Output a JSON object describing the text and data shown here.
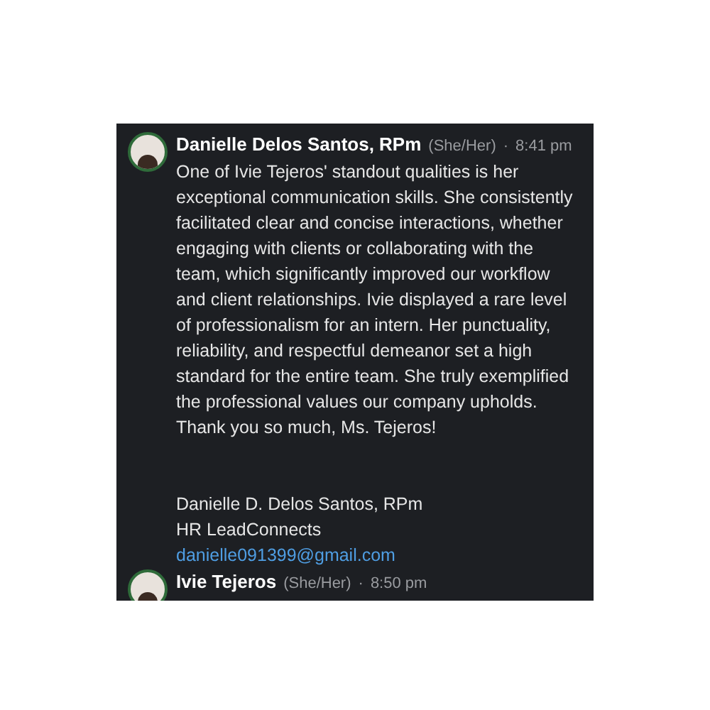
{
  "messages": [
    {
      "author": "Danielle Delos Santos, RPm",
      "pronouns": "(She/Her)",
      "separator": "·",
      "time": "8:41 pm",
      "body_lines": [
        "One of Ivie Tejeros' standout qualities is her",
        "exceptional communication skills. She consistently",
        "facilitated clear and concise interactions, whether",
        "engaging with clients or collaborating with the",
        "team, which significantly improved our workflow",
        "and client relationships. Ivie displayed a rare level",
        "of professionalism for an intern. Her punctuality,",
        "reliability, and respectful demeanor set a high",
        "standard for the entire team. She truly exemplified",
        "the professional values our company upholds.",
        "Thank you so much, Ms. Tejeros!"
      ],
      "signature": [
        "Danielle D. Delos Santos, RPm",
        "HR LeadConnects"
      ],
      "email": "danielle091399@gmail.com"
    },
    {
      "author": "Ivie Tejeros",
      "pronouns": "(She/Her)",
      "separator": "·",
      "time": "8:50 pm"
    }
  ]
}
